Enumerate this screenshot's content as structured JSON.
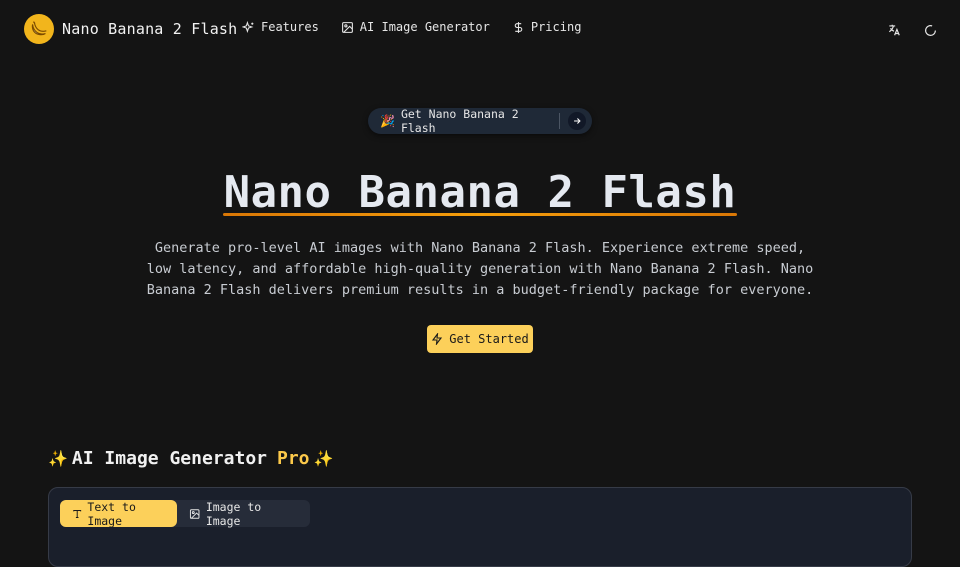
{
  "header": {
    "brand_name": "Nano Banana 2 Flash",
    "logo_icon": "banana-icon",
    "nav": [
      {
        "label": "Features",
        "icon": "sparkles-icon"
      },
      {
        "label": "AI Image Generator",
        "icon": "image-icon"
      },
      {
        "label": "Pricing",
        "icon": "dollar-icon"
      }
    ],
    "right_icons": [
      "translate-icon",
      "theme-toggle-icon"
    ]
  },
  "announcement": {
    "emoji": "🎉",
    "label": "Get Nano Banana 2 Flash",
    "icon": "arrow-right-icon"
  },
  "hero": {
    "title": "Nano Banana 2 Flash",
    "description": "Generate pro-level AI images with Nano Banana 2 Flash. Experience extreme speed, low latency, and affordable high-quality generation with Nano Banana 2 Flash. Nano Banana 2 Flash delivers premium results in a budget-friendly package for everyone.",
    "cta_label": "Get Started",
    "cta_icon": "lightning-icon"
  },
  "generator": {
    "title_prefix": "✨",
    "title": "AI Image Generator",
    "title_badge": "Pro",
    "title_suffix": "✨",
    "tabs": [
      {
        "label": "Text to Image",
        "icon": "text-icon",
        "active": true
      },
      {
        "label": "Image to Image",
        "icon": "image-icon",
        "active": false
      }
    ]
  },
  "colors": {
    "background": "#141414",
    "accent": "#fcd05a",
    "underline": "#f59e0b",
    "panel": "#1a1f2b"
  }
}
